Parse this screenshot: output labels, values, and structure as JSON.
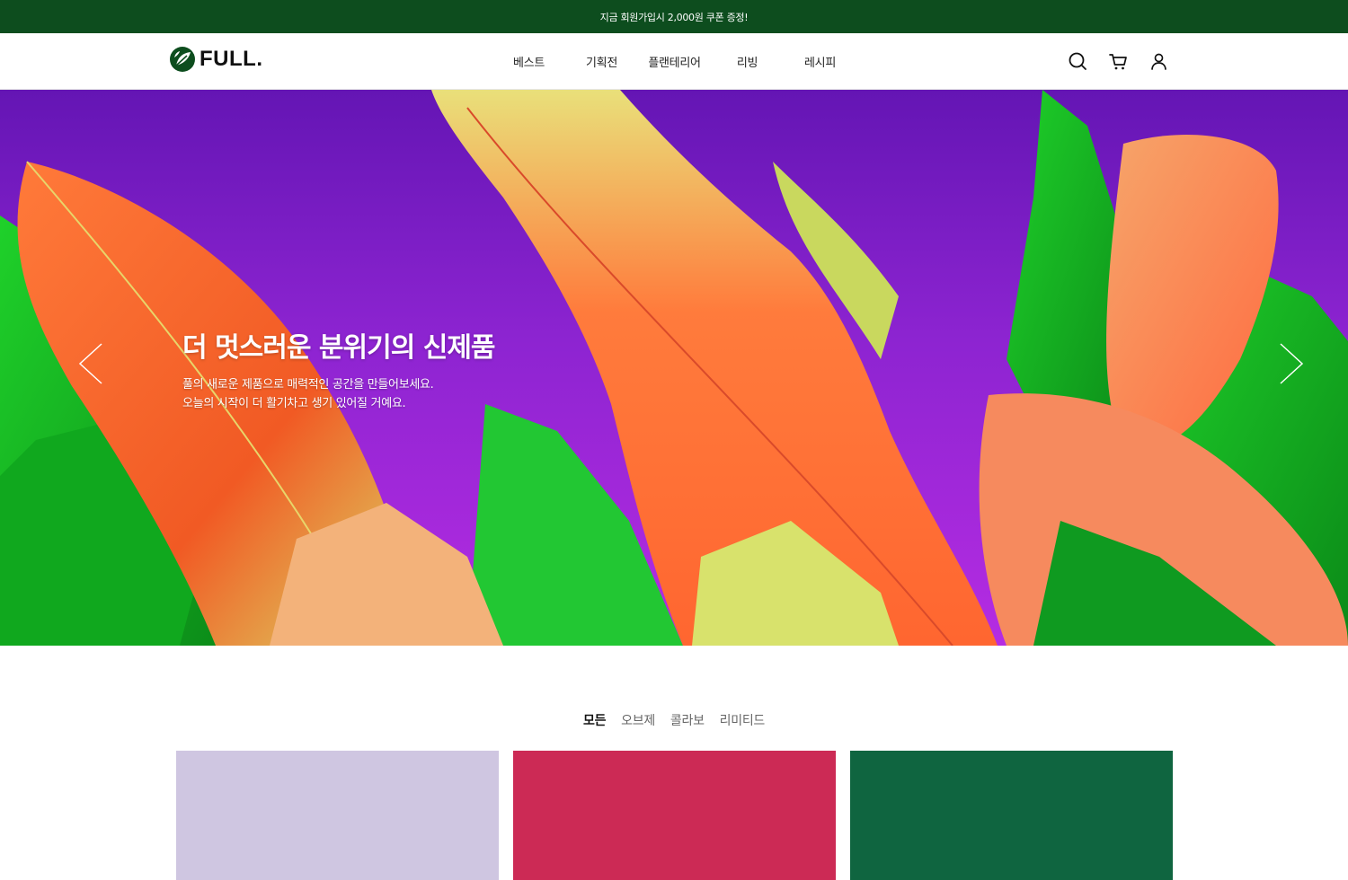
{
  "promo": {
    "text": "지금 회원가입시 2,000원 쿠폰 증정!"
  },
  "header": {
    "logo_text": "FULL.",
    "nav": [
      {
        "label": "베스트"
      },
      {
        "label": "기획전"
      },
      {
        "label": "플랜테리어"
      },
      {
        "label": "리빙"
      },
      {
        "label": "레시피"
      }
    ],
    "icons": [
      "search-icon",
      "cart-icon",
      "user-icon"
    ]
  },
  "hero": {
    "title": "더 멋스러운 분위기의 신제품",
    "desc_line1": "풀의 새로운 제품으로 매력적인 공간을 만들어보세요.",
    "desc_line2": "오늘의 시작이 더 활기차고 생기 있어질 거예요."
  },
  "tabs": [
    {
      "label": "모든",
      "active": true
    },
    {
      "label": "오브제",
      "active": false
    },
    {
      "label": "콜라보",
      "active": false
    },
    {
      "label": "리미티드",
      "active": false
    }
  ],
  "cards": [
    {
      "color": "#cfc6e1"
    },
    {
      "color": "#cc2a55"
    },
    {
      "color": "#0f6540"
    }
  ],
  "colors": {
    "brand_green": "#0d4d1e",
    "hero_purple": "#7a1ec8"
  }
}
